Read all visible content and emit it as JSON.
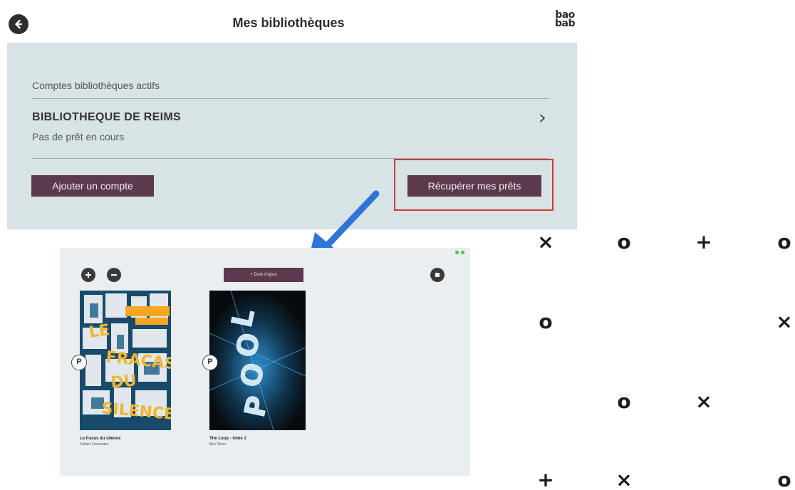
{
  "header": {
    "title": "Mes bibliothèques",
    "back_icon": "arrow-left-icon",
    "logo_line1": "bao",
    "logo_line2": "bab"
  },
  "libraries": {
    "section_label": "Comptes bibliothèques actifs",
    "items": [
      {
        "name": "BIBLIOTHEQUE DE REIMS",
        "status": "Pas de prêt en cours",
        "icon": "chevron-right-icon"
      }
    ]
  },
  "actions": {
    "add_account": "Ajouter un compte",
    "fetch_loans": "Récupérer mes prêts"
  },
  "annotation": {
    "highlight_color": "#cc3b3b",
    "arrow_color": "#2f74d8"
  },
  "embedded_screen": {
    "sort_button": "+ Date d'ajout",
    "books": [
      {
        "title": "Le fracas du silence",
        "author": "Fabien Fernandez",
        "badge": "P"
      },
      {
        "title": "The Loop - tome 1",
        "author": "Ben Oliver",
        "badge": "P"
      }
    ]
  },
  "symbols": [
    "×",
    "o",
    "+",
    "o",
    "o",
    "×",
    "o",
    "×",
    "+",
    "×",
    "o"
  ],
  "colors": {
    "panel_bg": "#d7e3e4",
    "button_bg": "#5b3a4d",
    "button_text": "#f2eef0"
  }
}
